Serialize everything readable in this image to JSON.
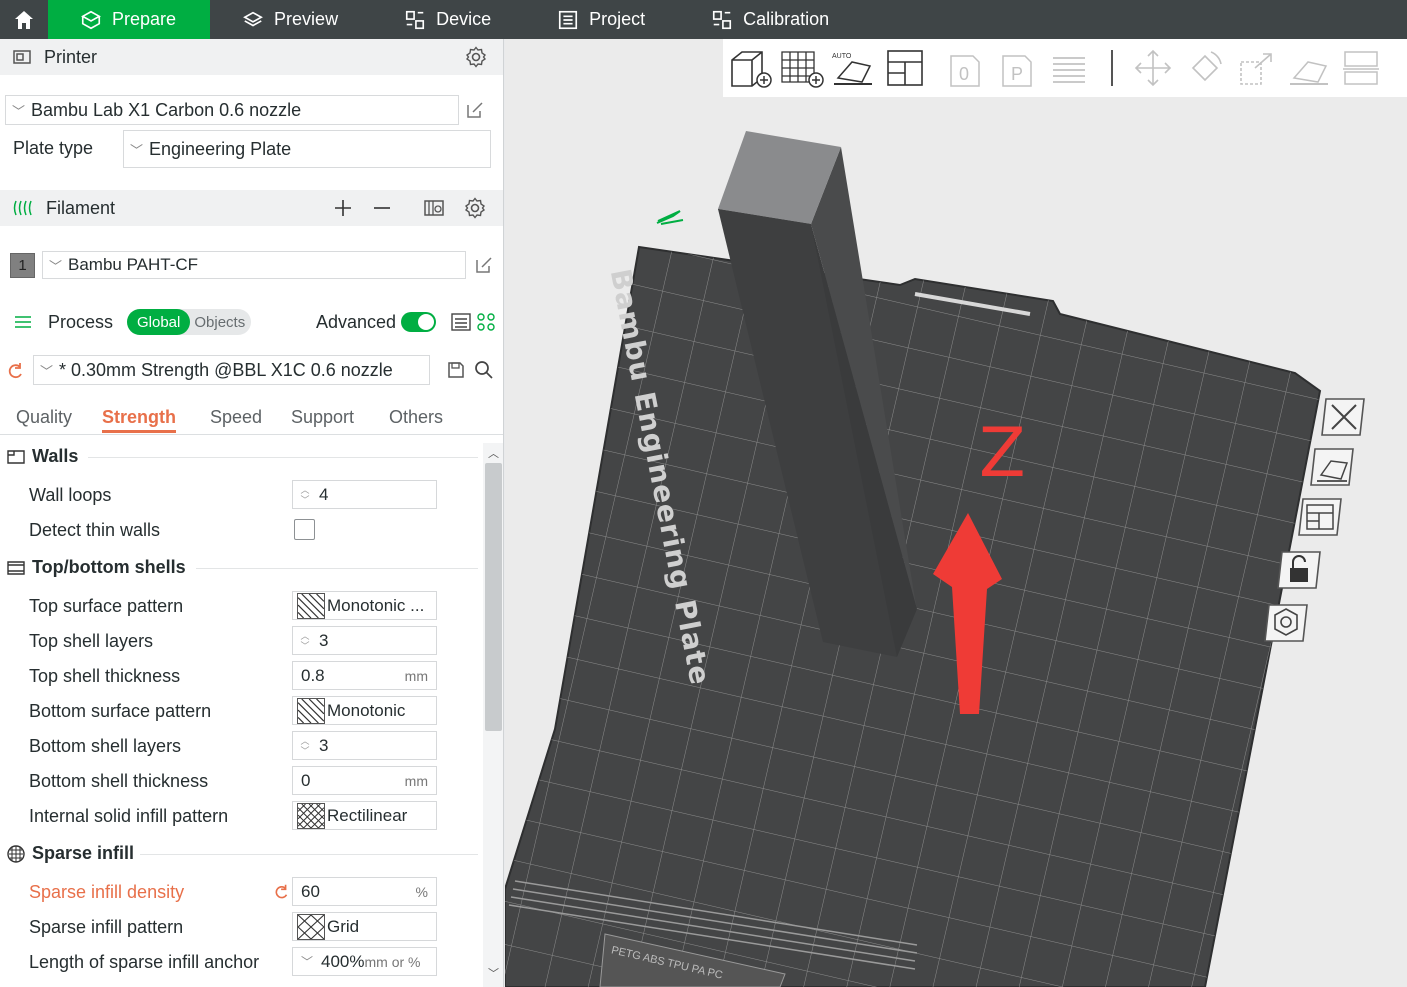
{
  "nav": {
    "tabs": [
      {
        "label": "Prepare"
      },
      {
        "label": "Preview"
      },
      {
        "label": "Device"
      },
      {
        "label": "Project"
      },
      {
        "label": "Calibration"
      }
    ]
  },
  "printer": {
    "section_title": "Printer",
    "selected_printer": "Bambu Lab X1 Carbon 0.6 nozzle",
    "plate_type_label": "Plate type",
    "plate_type_value": "Engineering Plate"
  },
  "filament": {
    "section_title": "Filament",
    "items": [
      {
        "index": "1",
        "name": "Bambu PAHT-CF",
        "color": "#808080"
      }
    ]
  },
  "process": {
    "section_title": "Process",
    "mode_global": "Global",
    "mode_objects": "Objects",
    "advanced_label": "Advanced",
    "advanced_on": true,
    "preset": "* 0.30mm Strength @BBL X1C 0.6 nozzle",
    "subtabs": [
      "Quality",
      "Strength",
      "Speed",
      "Support",
      "Others"
    ],
    "active_subtab": "Strength"
  },
  "settings": {
    "walls": {
      "title": "Walls",
      "wall_loops": {
        "label": "Wall loops",
        "value": "4"
      },
      "detect_thin_walls": {
        "label": "Detect thin walls",
        "checked": false
      }
    },
    "shells": {
      "title": "Top/bottom shells",
      "top_surface_pattern": {
        "label": "Top surface pattern",
        "value": "Monotonic ..."
      },
      "top_shell_layers": {
        "label": "Top shell layers",
        "value": "3"
      },
      "top_shell_thickness": {
        "label": "Top shell thickness",
        "value": "0.8",
        "unit": "mm"
      },
      "bottom_surface_pattern": {
        "label": "Bottom surface pattern",
        "value": "Monotonic"
      },
      "bottom_shell_layers": {
        "label": "Bottom shell layers",
        "value": "3"
      },
      "bottom_shell_thickness": {
        "label": "Bottom shell thickness",
        "value": "0",
        "unit": "mm"
      },
      "internal_solid_infill_pattern": {
        "label": "Internal solid infill pattern",
        "value": "Rectilinear"
      }
    },
    "infill": {
      "title": "Sparse infill",
      "density": {
        "label": "Sparse infill density",
        "value": "60",
        "unit": "%"
      },
      "pattern": {
        "label": "Sparse infill pattern",
        "value": "Grid"
      },
      "anchor": {
        "label": "Length of sparse infill anchor",
        "value": "400%",
        "unit": "mm or %"
      }
    }
  },
  "viewport": {
    "plate_label": "Bambu Engineering Plate",
    "plate_small_label": "PETG ABS TPU PA PC",
    "axis_label": "Z",
    "accent": "#00ae42",
    "axis_color": "#ef3b36"
  }
}
